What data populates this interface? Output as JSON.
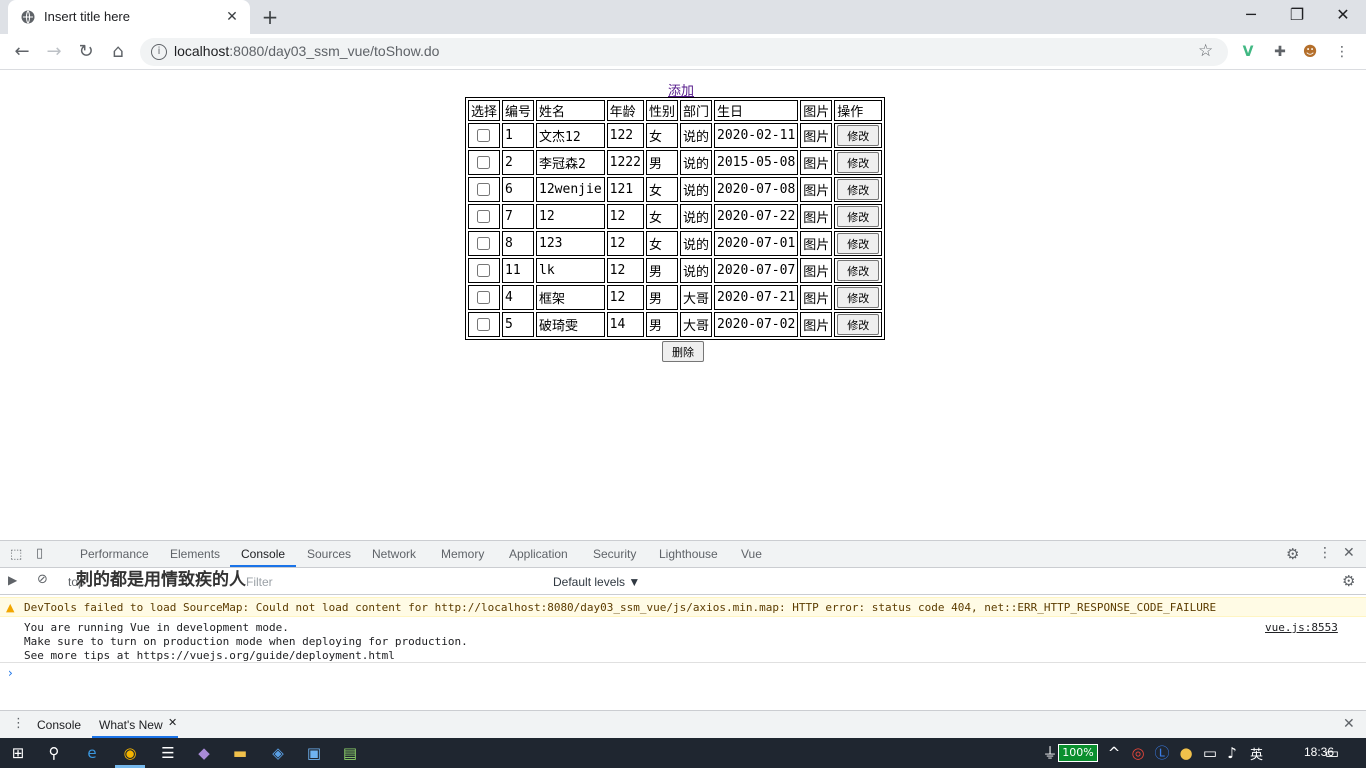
{
  "browser": {
    "tab_title": "Insert title here",
    "url_host": "localhost",
    "url_path": ":8080/day03_ssm_vue/toShow.do"
  },
  "page": {
    "add_link": "添加",
    "headers": [
      "选择",
      "编号",
      "姓名",
      "年龄",
      "性别",
      "部门",
      "生日",
      "图片",
      "操作"
    ],
    "rows": [
      {
        "id": "1",
        "name": "文杰12",
        "age": "122",
        "gender": "女",
        "dept": "说的",
        "birthday": "2020-02-11",
        "img": "图片",
        "action": "修改"
      },
      {
        "id": "2",
        "name": "李冠森2",
        "age": "1222",
        "gender": "男",
        "dept": "说的",
        "birthday": "2015-05-08",
        "img": "图片",
        "action": "修改"
      },
      {
        "id": "6",
        "name": "12wenjie",
        "age": "121",
        "gender": "女",
        "dept": "说的",
        "birthday": "2020-07-08",
        "img": "图片",
        "action": "修改"
      },
      {
        "id": "7",
        "name": "12",
        "age": "12",
        "gender": "女",
        "dept": "说的",
        "birthday": "2020-07-22",
        "img": "图片",
        "action": "修改"
      },
      {
        "id": "8",
        "name": "123",
        "age": "12",
        "gender": "女",
        "dept": "说的",
        "birthday": "2020-07-01",
        "img": "图片",
        "action": "修改"
      },
      {
        "id": "11",
        "name": "lk",
        "age": "12",
        "gender": "男",
        "dept": "说的",
        "birthday": "2020-07-07",
        "img": "图片",
        "action": "修改"
      },
      {
        "id": "4",
        "name": "框架",
        "age": "12",
        "gender": "男",
        "dept": "大哥",
        "birthday": "2020-07-21",
        "img": "图片",
        "action": "修改"
      },
      {
        "id": "5",
        "name": "破琦雯",
        "age": "14",
        "gender": "男",
        "dept": "大哥",
        "birthday": "2020-07-02",
        "img": "图片",
        "action": "修改"
      }
    ],
    "delete_button": "删除"
  },
  "devtools": {
    "tabs": [
      "Performance",
      "Elements",
      "Console",
      "Sources",
      "Network",
      "Memory",
      "Application",
      "Security",
      "Lighthouse",
      "Vue"
    ],
    "active_tab": "Console",
    "context": "top",
    "filter_placeholder": "Filter",
    "levels": "Default levels ▼",
    "overlay_text": "刺的都是用情致疾的人",
    "warning_prefix": "DevTools failed to load SourceMap: Could not load content for ",
    "warning_link": "http://localhost:8080/day03_ssm_vue/js/axios.min.map",
    "warning_suffix": ": HTTP error: status code 404, net::ERR_HTTP_RESPONSE_CODE_FAILURE",
    "log_lines": "You are running Vue in development mode.\nMake sure to turn on production mode when deploying for production.\nSee more tips at ",
    "log_link": "https://vuejs.org/guide/deployment.html",
    "log_source": "vue.js:8553",
    "drawer_tabs": [
      "Console",
      "What's New"
    ]
  },
  "taskbar": {
    "battery": "100%",
    "ime": "英",
    "clock": "18:36"
  }
}
